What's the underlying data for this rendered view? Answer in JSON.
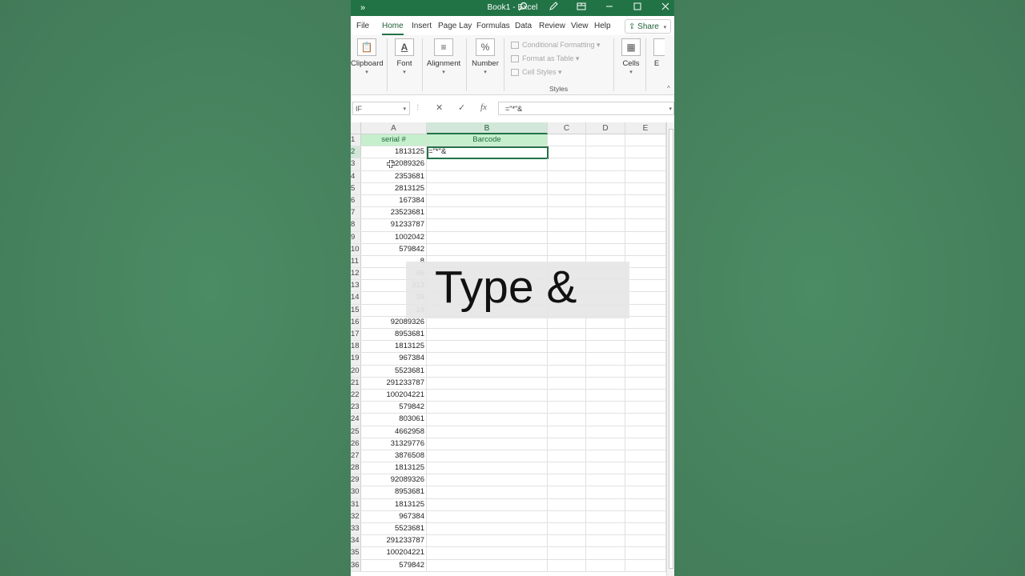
{
  "window": {
    "title": "Book1  -  Excel",
    "more_glyph": "»"
  },
  "tabs": [
    "File",
    "Home",
    "Insert",
    "Page Lay",
    "Formulas",
    "Data",
    "Review",
    "View",
    "Help"
  ],
  "share_label": "Share",
  "ribbon": {
    "clipboard": "Clipboard",
    "font": "Font",
    "alignment": "Alignment",
    "number": "Number",
    "cells": "Cells",
    "editing_cut": "E",
    "styles_items": [
      "Conditional Formatting",
      "Format as Table",
      "Cell Styles"
    ],
    "styles_label": "Styles"
  },
  "formula_bar": {
    "name_box": "IF",
    "formula": "=\"*\"&"
  },
  "columns": [
    "A",
    "B",
    "C",
    "D",
    "E"
  ],
  "header_row": {
    "a": "serial #",
    "b": "Barcode"
  },
  "active_cell_text": "=\"*\"&",
  "rows": [
    {
      "n": "1"
    },
    {
      "n": "2",
      "a": "1813125"
    },
    {
      "n": "3",
      "a": "92089326"
    },
    {
      "n": "4",
      "a": "2353681"
    },
    {
      "n": "5",
      "a": "2813125"
    },
    {
      "n": "6",
      "a": "167384"
    },
    {
      "n": "7",
      "a": "23523681"
    },
    {
      "n": "8",
      "a": "91233787"
    },
    {
      "n": "9",
      "a": "1002042"
    },
    {
      "n": "10",
      "a": "579842"
    },
    {
      "n": "11",
      "a": "8"
    },
    {
      "n": "12",
      "a": "46"
    },
    {
      "n": "13",
      "a": "313"
    },
    {
      "n": "14",
      "a": "38"
    },
    {
      "n": "15",
      "a": "18"
    },
    {
      "n": "16",
      "a": "92089326"
    },
    {
      "n": "17",
      "a": "8953681"
    },
    {
      "n": "18",
      "a": "1813125"
    },
    {
      "n": "19",
      "a": "967384"
    },
    {
      "n": "20",
      "a": "5523681"
    },
    {
      "n": "21",
      "a": "291233787"
    },
    {
      "n": "22",
      "a": "100204221"
    },
    {
      "n": "23",
      "a": "579842"
    },
    {
      "n": "24",
      "a": "803061"
    },
    {
      "n": "25",
      "a": "4662958"
    },
    {
      "n": "26",
      "a": "31329776"
    },
    {
      "n": "27",
      "a": "3876508"
    },
    {
      "n": "28",
      "a": "1813125"
    },
    {
      "n": "29",
      "a": "92089326"
    },
    {
      "n": "30",
      "a": "8953681"
    },
    {
      "n": "31",
      "a": "1813125"
    },
    {
      "n": "32",
      "a": "967384"
    },
    {
      "n": "33",
      "a": "5523681"
    },
    {
      "n": "34",
      "a": "291233787"
    },
    {
      "n": "35",
      "a": "100204221"
    },
    {
      "n": "36",
      "a": "579842"
    }
  ],
  "overlay_text": "Type &"
}
